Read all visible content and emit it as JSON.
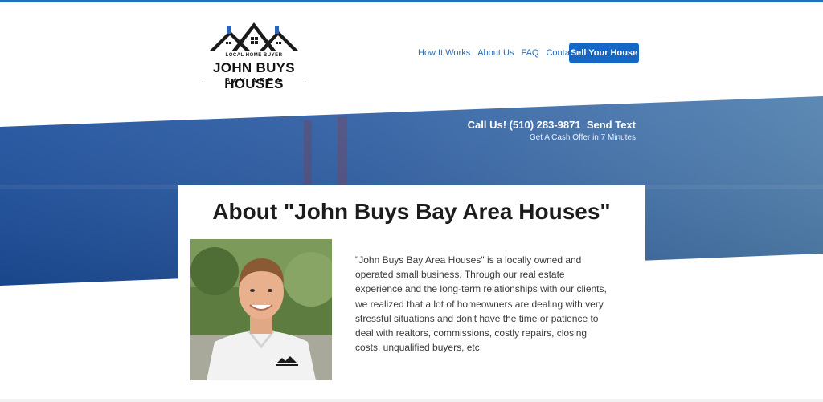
{
  "brand": {
    "tagline": "LOCAL HOME BUYER",
    "name": "JOHN BUYS HOUSES",
    "region": "BAY AREA",
    "accent": "#1567c5"
  },
  "nav": {
    "items": [
      "How It Works",
      "About Us",
      "FAQ",
      "Contact Us"
    ],
    "cta_label": "Sell Your House"
  },
  "hero": {
    "call_text": "Call Us! (510) 283-9871",
    "text_label": "Send Text",
    "offer_text": "Get A Cash Offer in 7 Minutes"
  },
  "about": {
    "heading": "About \"John Buys Bay Area Houses\"",
    "body": "\"John Buys Bay Area Houses\" is a locally owned and operated small business. Through our real estate experience and the long-term relationships with our clients, we realized that a lot of homeowners are dealing with very stressful situations and don't have the time or patience to deal with realtors, commissions, costly repairs, closing costs, unqualified buyers, etc.",
    "photo_icon": "portrait-photo"
  }
}
